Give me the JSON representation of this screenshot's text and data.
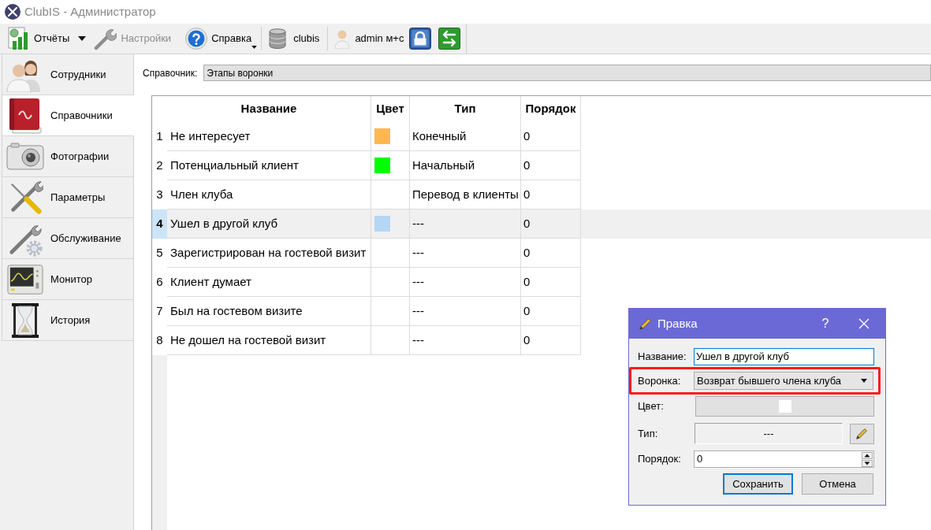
{
  "window": {
    "title": "ClubIS - Администратор"
  },
  "toolbar": {
    "reports": {
      "label": "Отчёты"
    },
    "settings": {
      "label": "Настройки",
      "disabled": true
    },
    "help": {
      "label": "Справка"
    },
    "database": {
      "label": "clubis"
    },
    "user": {
      "label": "admin м+с"
    }
  },
  "sidebar": {
    "items": [
      {
        "label": "Сотрудники",
        "selected": false
      },
      {
        "label": "Справочники",
        "selected": true
      },
      {
        "label": "Фотографии",
        "selected": false
      },
      {
        "label": "Параметры",
        "selected": false
      },
      {
        "label": "Обслуживание",
        "selected": false
      },
      {
        "label": "Монитор",
        "selected": false
      },
      {
        "label": "История",
        "selected": false
      }
    ]
  },
  "reference": {
    "label": "Справочник:",
    "value": "Этапы воронки"
  },
  "table": {
    "columns": [
      "Название",
      "Цвет",
      "Тип",
      "Порядок"
    ],
    "rows": [
      {
        "number": "1",
        "name": "Не интересует",
        "color": "#ffb84d",
        "type": "Конечный",
        "order": "0",
        "selected": false
      },
      {
        "number": "2",
        "name": "Потенциальный клиент",
        "color": "#00ff00",
        "type": "Начальный",
        "order": "0",
        "selected": false
      },
      {
        "number": "3",
        "name": "Член клуба",
        "type": "Перевод в клиенты",
        "order": "0",
        "selected": false
      },
      {
        "number": "4",
        "name": "Ушел в другой клуб",
        "color": "#b5d6f4",
        "type": "---",
        "order": "0",
        "selected": true
      },
      {
        "number": "5",
        "name": "Зарегистрирован на гостевой визит",
        "type": "---",
        "order": "0",
        "selected": false
      },
      {
        "number": "6",
        "name": "Клиент думает",
        "type": "---",
        "order": "0",
        "selected": false
      },
      {
        "number": "7",
        "name": "Был на гостевом визите",
        "type": "---",
        "order": "0",
        "selected": false
      },
      {
        "number": "8",
        "name": "Не дошел на гостевой визит",
        "type": "---",
        "order": "0",
        "selected": false
      }
    ]
  },
  "dialog": {
    "title": "Правка",
    "help": "?",
    "fields": [
      {
        "kind": "text",
        "label": "Название:",
        "value": "Ушел в другой клуб",
        "focused": true,
        "highlighted": false
      },
      {
        "kind": "combo",
        "label": "Воронка:",
        "value": "Возврат бывшего члена клуба",
        "focused": false,
        "highlighted": true
      },
      {
        "kind": "color",
        "label": "Цвет:",
        "color": "#ffffff",
        "focused": false,
        "highlighted": false
      },
      {
        "kind": "picker",
        "label": "Тип:",
        "value": "---",
        "focused": false,
        "highlighted": false
      },
      {
        "kind": "spin",
        "label": "Порядок:",
        "value": "0",
        "focused": false,
        "highlighted": false
      }
    ],
    "buttons": [
      {
        "label": "Сохранить",
        "default": true
      },
      {
        "label": "Отмена",
        "default": false
      }
    ]
  }
}
